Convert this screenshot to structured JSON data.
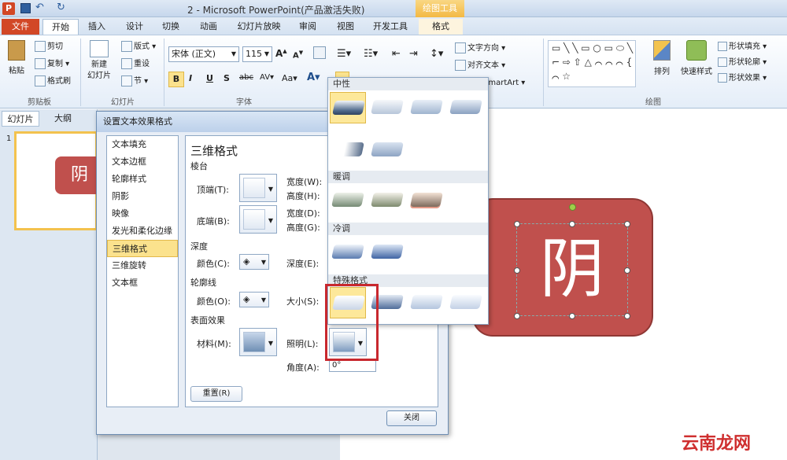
{
  "titlebar": {
    "title": "2 - Microsoft PowerPoint(产品激活失败)",
    "context_tab": "绘图工具"
  },
  "tabs": [
    "文件",
    "开始",
    "插入",
    "设计",
    "切换",
    "动画",
    "幻灯片放映",
    "审阅",
    "视图",
    "开发工具",
    "格式"
  ],
  "ribbon": {
    "clipboard": {
      "paste": "粘贴",
      "cut": "剪切",
      "copy": "复制",
      "format_painter": "格式刷",
      "label": "剪贴板"
    },
    "slides": {
      "new_slide": "新建\n幻灯片",
      "layout": "版式",
      "reset": "重设",
      "section": "节",
      "label": "幻灯片"
    },
    "font": {
      "name": "宋体 (正文)",
      "size": "115",
      "label": "字体"
    },
    "paragraph": {
      "text_direction": "文字方向",
      "align_text": "对齐文本",
      "smartart": "SmartArt"
    },
    "drawing": {
      "arrange": "排列",
      "quick_styles": "快速样式",
      "fill": "形状填充",
      "outline": "形状轮廓",
      "effects": "形状效果",
      "label": "绘图"
    }
  },
  "leftpane": {
    "tab_slides": "幻灯片",
    "tab_outline": "大纲",
    "slide_number": "1",
    "thumb_text": "阴"
  },
  "dialog": {
    "title": "设置文本效果格式",
    "categories": [
      "文本填充",
      "文本边框",
      "轮廓样式",
      "阴影",
      "映像",
      "发光和柔化边缘",
      "三维格式",
      "三维旋转",
      "文本框"
    ],
    "selected_category": "三维格式",
    "heading": "三维格式",
    "bevel_section": "棱台",
    "top_label": "顶端(T):",
    "bottom_label": "底端(B):",
    "width_w": "宽度(W):",
    "height_h": "高度(H):",
    "width_d": "宽度(D):",
    "height_g": "高度(G):",
    "depth_section": "深度",
    "depth_color": "颜色(C):",
    "depth_e": "深度(E):",
    "contour_section": "轮廓线",
    "contour_color": "颜色(O):",
    "contour_size": "大小(S):",
    "surface_section": "表面效果",
    "material": "材料(M):",
    "lighting": "照明(L):",
    "angle": "角度(A):",
    "angle_value": "0°",
    "reset": "重置(R)",
    "close": "关闭"
  },
  "gallery": {
    "neutral": "中性",
    "warm": "暖调",
    "cool": "冷调",
    "special": "特殊格式"
  },
  "slide": {
    "shape_text": "阴"
  },
  "watermark": "云南龙网",
  "colors": {
    "shape": "#c0504d",
    "file_tab": "#d24726",
    "highlight": "#fbe28d",
    "callout": "#c8282e"
  }
}
